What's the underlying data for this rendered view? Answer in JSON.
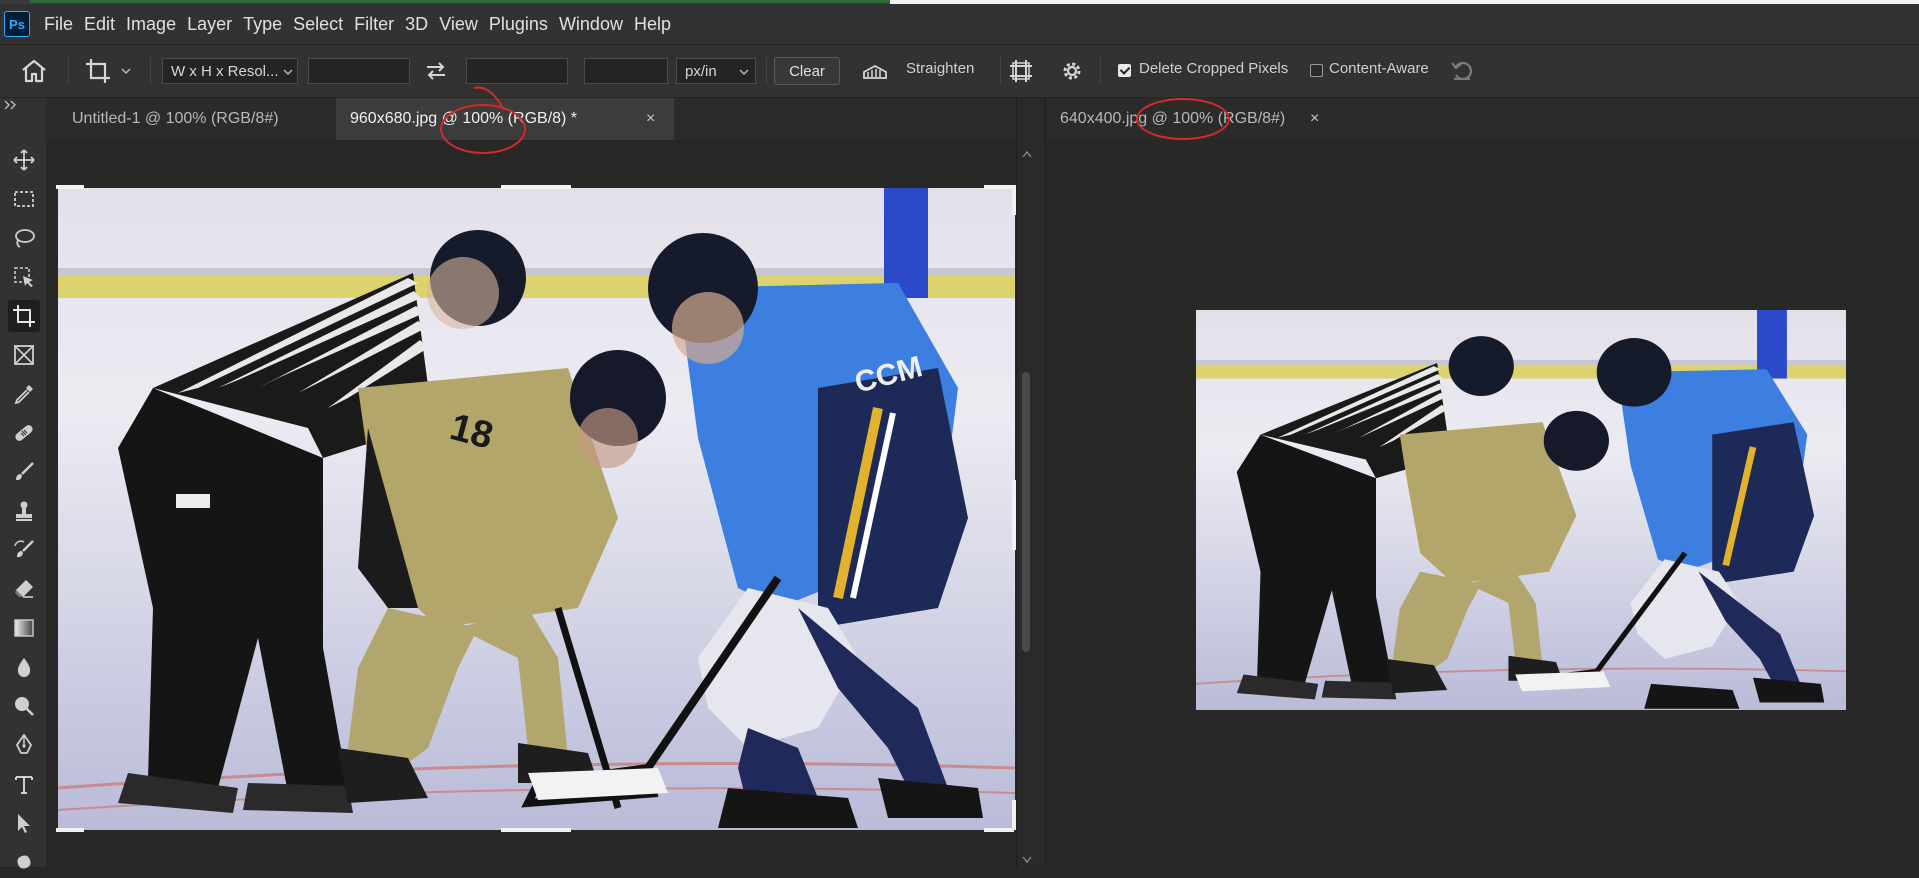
{
  "app": {
    "logo_text": "Ps"
  },
  "menu": [
    "File",
    "Edit",
    "Image",
    "Layer",
    "Type",
    "Select",
    "Filter",
    "3D",
    "View",
    "Plugins",
    "Window",
    "Help"
  ],
  "options": {
    "ratio_preset": "W x H x Resol...",
    "width_value": "",
    "height_value": "",
    "resolution_value": "",
    "resolution_unit": "px/in",
    "clear_label": "Clear",
    "straighten_label": "Straighten",
    "delete_cropped_label": "Delete Cropped Pixels",
    "delete_cropped_checked": true,
    "content_aware_label": "Content-Aware",
    "content_aware_checked": false
  },
  "tabs_left": [
    {
      "label": "Untitled-1 @ 100% (RGB/8#)",
      "active": false
    },
    {
      "label": "960x680.jpg @ 100% (RGB/8) *",
      "active": true
    }
  ],
  "tabs_right": [
    {
      "label": "640x400.jpg @ 100% (RGB/8#)",
      "active": false
    }
  ],
  "tools": [
    "move-icon",
    "marquee-icon",
    "lasso-icon",
    "object-select-icon",
    "crop-icon",
    "frame-icon",
    "eyedropper-icon",
    "healing-brush-icon",
    "brush-icon",
    "clone-stamp-icon",
    "history-brush-icon",
    "eraser-icon",
    "gradient-icon",
    "blur-icon",
    "dodge-icon",
    "pen-icon",
    "type-icon",
    "path-select-icon",
    "shape-icon"
  ],
  "colors": {
    "accent": "#31a8ff",
    "annotation": "#d42a2a",
    "jersey_blue": "#3d7fe0",
    "jersey_gold": "#b3a66a"
  }
}
